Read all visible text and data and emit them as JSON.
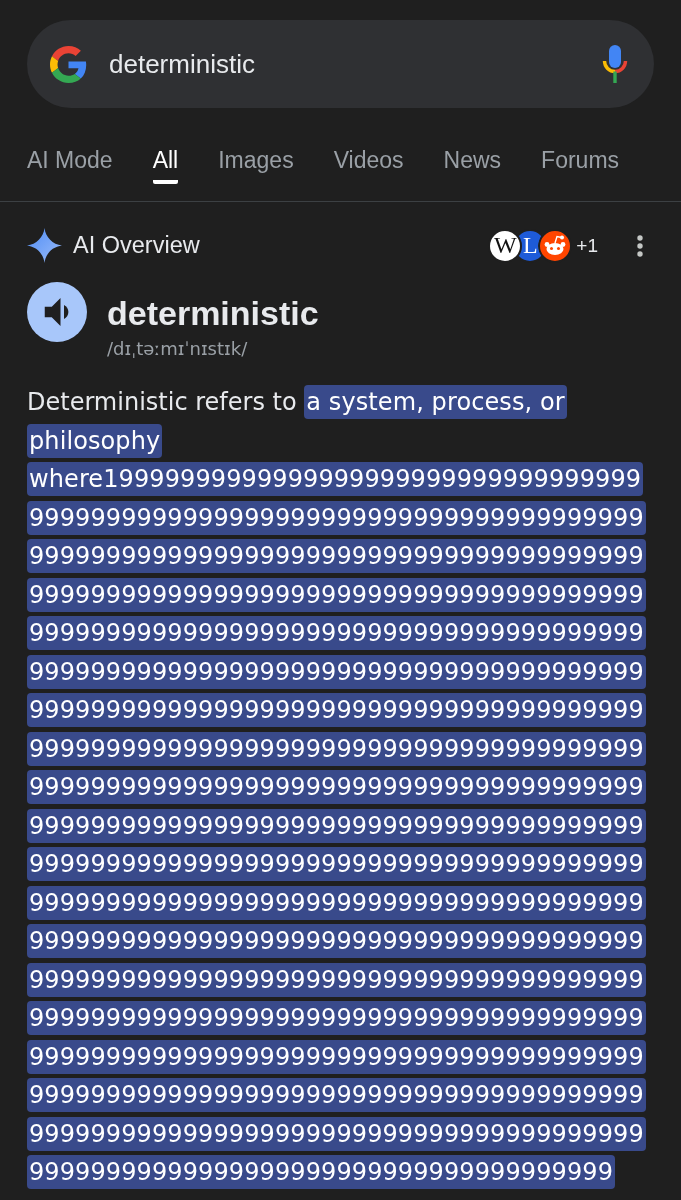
{
  "search": {
    "value": "deterministic"
  },
  "tabs": [
    {
      "label": "AI Mode",
      "selected": false
    },
    {
      "label": "All",
      "selected": true
    },
    {
      "label": "Images",
      "selected": false
    },
    {
      "label": "Videos",
      "selected": false
    },
    {
      "label": "News",
      "selected": false
    },
    {
      "label": "Forums",
      "selected": false
    }
  ],
  "ai_overview": {
    "title": "AI Overview",
    "sources": [
      {
        "kind": "letter",
        "letter": "W",
        "color": "#ffffff"
      },
      {
        "kind": "letter",
        "letter": "L",
        "color": "#1e5bd8"
      },
      {
        "kind": "alien",
        "color": "#ff4500"
      }
    ],
    "more_count": "+1"
  },
  "dictionary": {
    "word": "deterministic",
    "pronunciation": "/dɪˌtəːmɪˈnɪstɪk/"
  },
  "overview": {
    "text": "Deterministic refers to ",
    "highlight": "a system, process, or philosophy where199999999999999999999999999999999999999999999999999999999999999999999999999999999999999999999999999999999999999999999999999999999999999999999999999999999999999999999999999999999999999999999999999999999999999999999999999999999999999999999999999999999999999999999999999999999999999999999999999999999999999999999999999999999999999999999999999999999999999999999999999999999999999999999999999999999999999999999999999999999999999999999999999999999999999999999999999999999999999999999999999999999999999999999999999999999999999999999999999999999999999999999999999999999999999999999999999999999999999999999999999999999999999999999999999999999999999999999999999999999999999999999999999999999999999999999999999999999999999999999999999999999999999999999999999999999"
  }
}
